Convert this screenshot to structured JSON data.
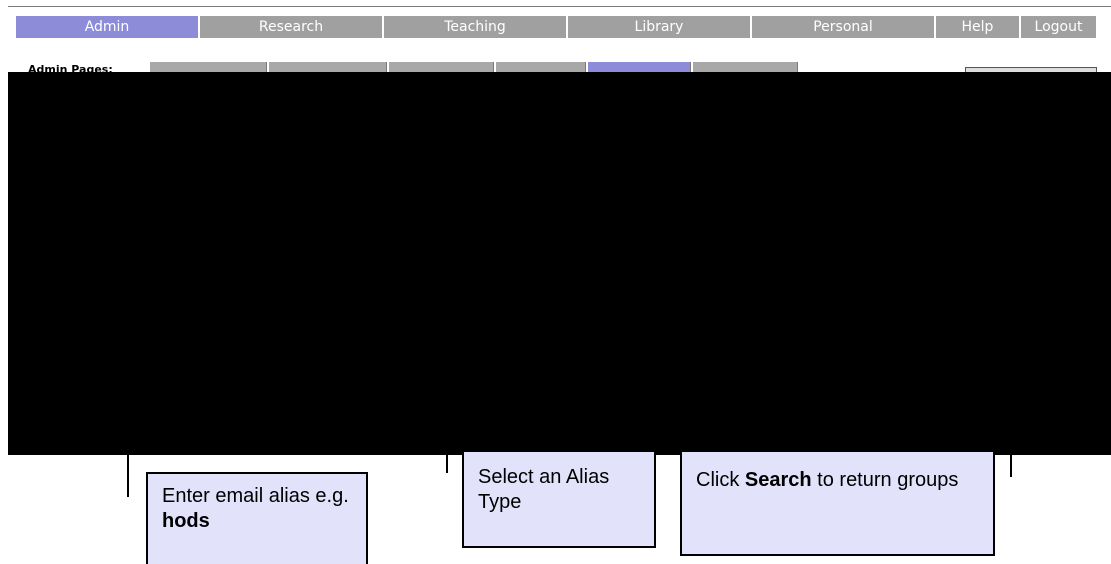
{
  "nav": {
    "tabs": [
      {
        "label": "Admin",
        "active": true
      },
      {
        "label": "Research",
        "active": false
      },
      {
        "label": "Teaching",
        "active": false
      },
      {
        "label": "Library",
        "active": false
      },
      {
        "label": "Personal",
        "active": false
      },
      {
        "label": "Help",
        "active": false
      },
      {
        "label": "Logout",
        "active": false
      }
    ]
  },
  "admin_pages_label": "Admin Pages:",
  "callouts": {
    "alias": {
      "text": "Enter email alias e.g. ",
      "bold": "hods"
    },
    "type": {
      "text": "Select an Alias Type"
    },
    "search": {
      "prefix": "Click ",
      "bold": "Search",
      "suffix": " to return groups"
    }
  },
  "colors": {
    "tab_inactive": "#a0a0a0",
    "tab_active": "#8c8cd9",
    "callout_bg": "#e2e2fb"
  }
}
